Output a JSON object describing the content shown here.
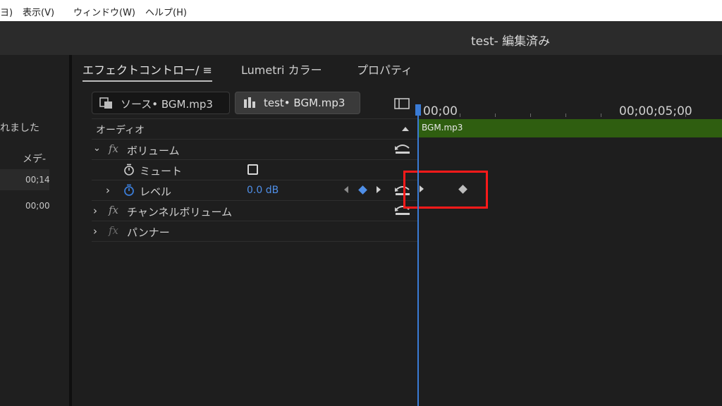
{
  "menubar": {
    "items": [
      "ヨ)",
      "表示(V)",
      "ウィンドウ(W)",
      "ヘルプ(H)"
    ]
  },
  "window": {
    "title": "test- 編集済み"
  },
  "left_panel": {
    "notice": "れました",
    "column_header": "メデ-",
    "rows": [
      "00;14",
      "00;00"
    ]
  },
  "tabs": [
    {
      "label": "エフェクトコントロー/ ≡"
    },
    {
      "label": "Lumetri カラー"
    },
    {
      "label": "プロパティ"
    }
  ],
  "source": {
    "source_label": "ソース• BGM.mp3",
    "sequence_label": "test• BGM.mp3"
  },
  "effects": {
    "section": "オーディオ",
    "volume": {
      "label": "ボリューム",
      "mute_label": "ミュート",
      "level_label": "レベル",
      "level_value": "0.0 dB"
    },
    "channel_volume_label": "チャンネルボリューム",
    "panner_label": "パンナー",
    "fx_symbol": "fx"
  },
  "timeline": {
    "timecode_start": "00;00",
    "timecode_mid": "00;00;05;00",
    "clip_name": "BGM.mp3"
  },
  "colors": {
    "accent_blue": "#3a7bd5",
    "clip_green": "#2f5e10",
    "highlight_red": "#ff1a1a"
  }
}
